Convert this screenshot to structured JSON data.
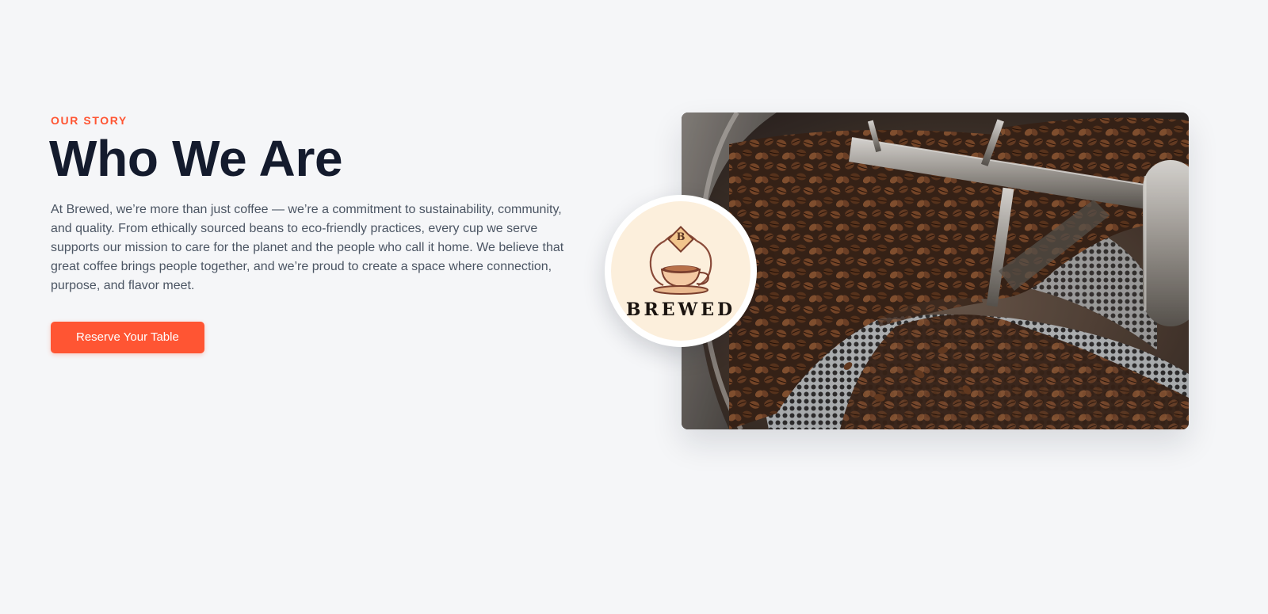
{
  "about": {
    "eyebrow": "OUR STORY",
    "title": "Who We Are",
    "description": "At Brewed, we’re more than just coffee — we’re a commitment to sustainability, community, and quality. From ethically sourced beans to eco-friendly practices, every cup we serve supports our mission to care for the planet and the people who call it home. We believe that great coffee brings people together, and we’re proud to create a space where connection, purpose, and flavor meet.",
    "cta_label": "Reserve Your Table"
  },
  "logo": {
    "brand_text": "BREWED",
    "monogram": "B"
  },
  "photo": {
    "subject": "coffee-roaster-beans"
  },
  "colors": {
    "accent": "#ff5533",
    "heading": "#141b2d",
    "body_text": "#4b5563",
    "background": "#f5f6f8",
    "logo_bg": "#fcefdc"
  }
}
